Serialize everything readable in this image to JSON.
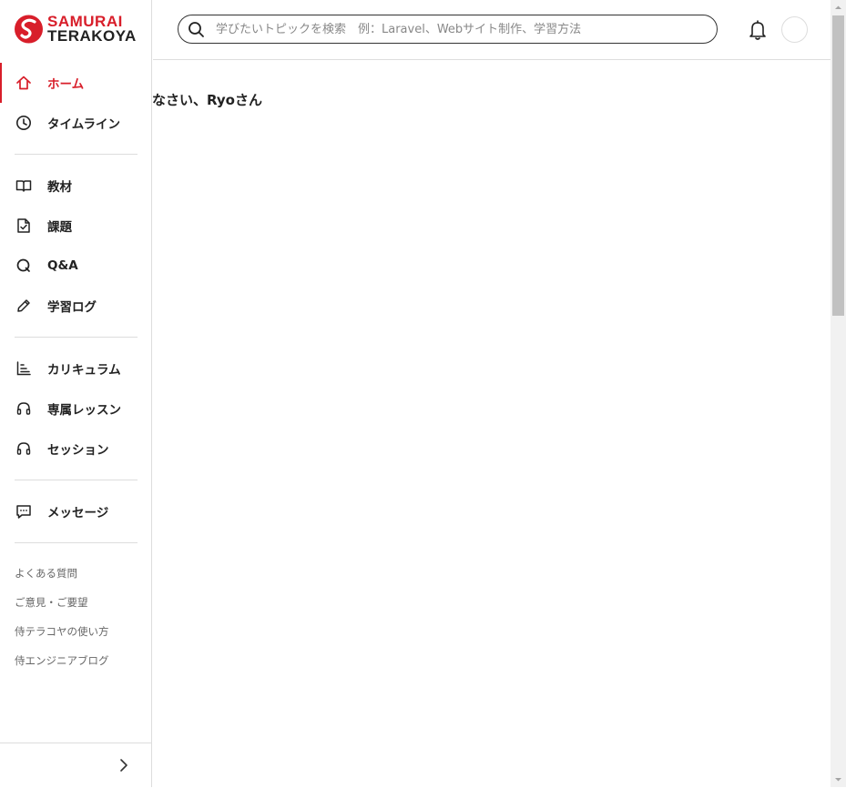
{
  "brand": {
    "line1": "SAMURAI",
    "line2": "TERAKOYA",
    "accent": "#d81e2a"
  },
  "search": {
    "placeholder": "学びたいトピックを検索　例：Laravel、Webサイト制作、学習方法",
    "value": ""
  },
  "header": {
    "icons": [
      "bell-icon",
      "avatar"
    ]
  },
  "main": {
    "greeting": "なさい、Ryoさん"
  },
  "sidebar": {
    "primary": [
      {
        "label": "ホーム",
        "icon": "home-icon",
        "active": true
      },
      {
        "label": "タイムライン",
        "icon": "clock-icon"
      }
    ],
    "learning": [
      {
        "label": "教材",
        "icon": "book-icon"
      },
      {
        "label": "課題",
        "icon": "task-icon"
      },
      {
        "label": "Q&A",
        "icon": "qa-icon"
      },
      {
        "label": "学習ログ",
        "icon": "pencil-icon"
      }
    ],
    "lessons": [
      {
        "label": "カリキュラム",
        "icon": "curriculum-icon"
      },
      {
        "label": "専属レッスン",
        "icon": "headset-icon"
      },
      {
        "label": "セッション",
        "icon": "headset-icon"
      }
    ],
    "messages": [
      {
        "label": "メッセージ",
        "icon": "chat-icon"
      }
    ],
    "links": [
      "よくある質問",
      "ご意見・ご要望",
      "侍テラコヤの使い方",
      "侍エンジニアブログ"
    ],
    "collapse_icon": "chevron-right-icon"
  }
}
